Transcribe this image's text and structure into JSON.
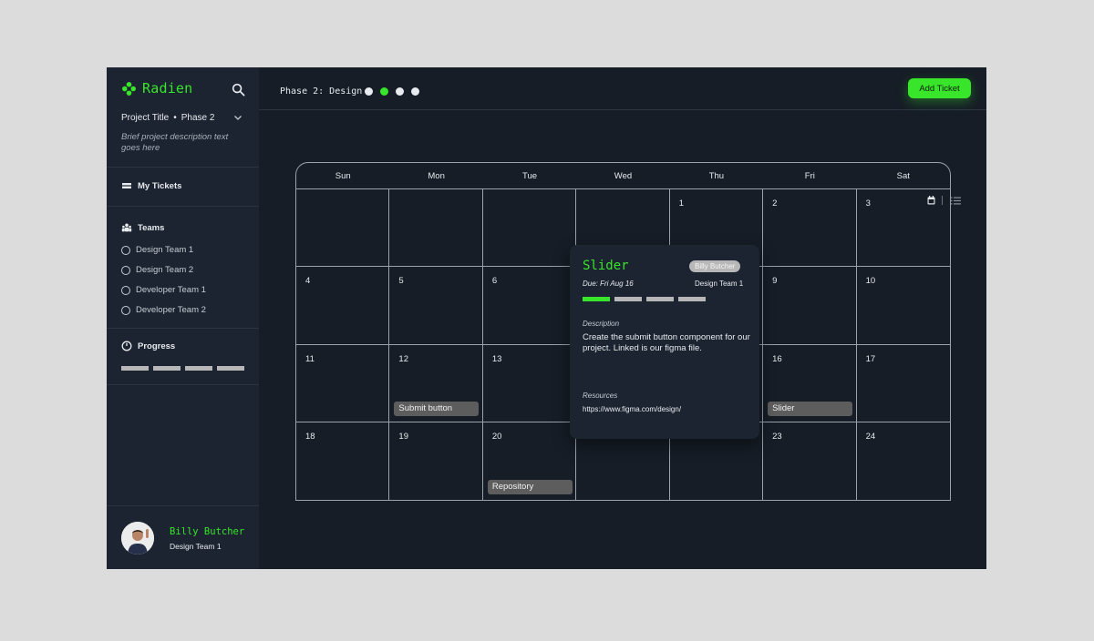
{
  "app": {
    "name": "Radien"
  },
  "project": {
    "title": "Project Title",
    "separator": "•",
    "phase": "Phase 2",
    "description": "Brief project description text goes here"
  },
  "nav": {
    "my_tickets": "My Tickets",
    "teams": "Teams",
    "progress": "Progress"
  },
  "teams": [
    "Design Team 1",
    "Design Team 2",
    "Developer Team 1",
    "Developer Team 2"
  ],
  "user": {
    "name": "Billy Butcher",
    "team": "Design Team 1"
  },
  "topbar": {
    "phase_label": "Phase 2: Design",
    "add_ticket": "Add Ticket",
    "current_step": 2,
    "total_steps": 4
  },
  "colors": {
    "accent": "#38e52a",
    "background": "#161d26",
    "sidebar": "#1b2430"
  },
  "calendar": {
    "days": [
      "Sun",
      "Mon",
      "Tue",
      "Wed",
      "Thu",
      "Fri",
      "Sat"
    ],
    "cells": [
      "",
      "",
      "",
      "",
      "1",
      "2",
      "3",
      "4",
      "5",
      "6",
      "",
      "",
      "9",
      "10",
      "11",
      "12",
      "13",
      "",
      "",
      "16",
      "17",
      "18",
      "19",
      "20",
      "",
      "",
      "23",
      "24"
    ],
    "events": [
      {
        "label": "Submit button",
        "cell": 15
      },
      {
        "label": "Slider",
        "cell": 19
      },
      {
        "label": "Repository",
        "cell": 23
      }
    ]
  },
  "popup": {
    "title": "Slider",
    "assignee": "Billy Butcher",
    "due": "Due: Fri Aug 16",
    "team": "Design Team 1",
    "progress_done": 1,
    "progress_total": 4,
    "description_label": "Description",
    "description": "Create the submit button component for our project. Linked is our figma file.",
    "resources_label": "Resources",
    "resource_url": "https://www.figma.com/design/"
  }
}
